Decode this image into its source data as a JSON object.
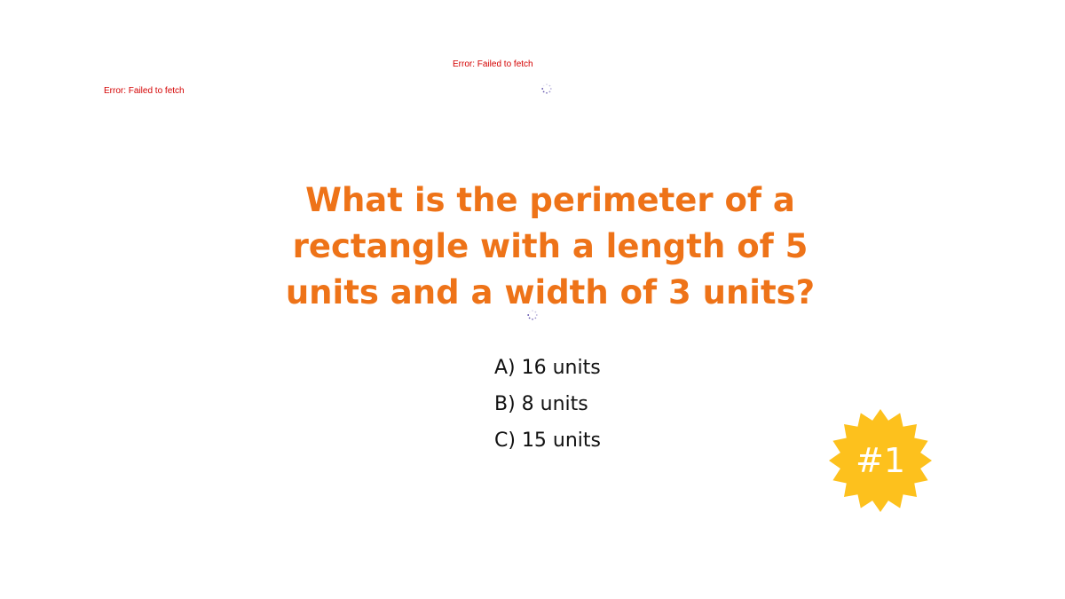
{
  "errors": {
    "top": "Error: Failed to fetch",
    "left": "Error: Failed to fetch"
  },
  "quiz": {
    "question": "What is the perimeter of a rectangle with a length of 5 units and a width of 3 units?",
    "options": [
      "A) 16 units",
      "B) 8 units",
      "C) 15 units"
    ],
    "badge": "#1"
  },
  "colors": {
    "question": "#ee7318",
    "error": "#d40000",
    "badge": "#fdc11d",
    "spinner": "#4a3aa0"
  },
  "icons": {
    "loading": "loading-spinner-icon",
    "badge_shape": "starburst-badge-icon"
  }
}
